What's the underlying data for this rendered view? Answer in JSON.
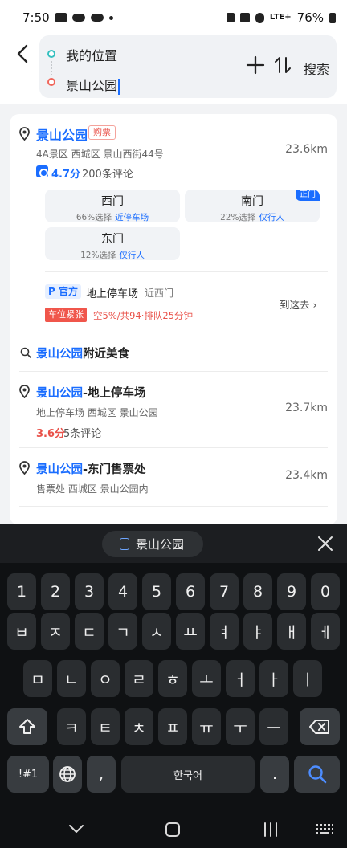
{
  "status": {
    "time": "7:50",
    "network": "LTE+",
    "battery": "76%"
  },
  "route": {
    "origin": "我的位置",
    "destination": "景山公园",
    "search_label": "搜索"
  },
  "results": {
    "primary": {
      "name": "景山公园",
      "badge": "购票",
      "meta": "4A景区  西城区 景山西街44号",
      "distance": "23.6km",
      "rating": "4.7分",
      "reviews": "200条评论",
      "gates": [
        {
          "name": "西门",
          "percent": "66%选择",
          "tip": "近停车场",
          "main": ""
        },
        {
          "name": "南门",
          "percent": "22%选择",
          "tip": "仅行人",
          "main": "正门"
        },
        {
          "name": "东门",
          "percent": "12%选择",
          "tip": "仅行人",
          "main": ""
        }
      ],
      "parking": {
        "badge": "P 官方",
        "name": "地上停车场",
        "near": "近西门",
        "status_badge": "车位紧张",
        "status_text": "空5%/共94·排队25分钟",
        "go_label": "到这去"
      }
    },
    "suggest": {
      "keyword": "景山公园",
      "suffix": "附近美食"
    },
    "items": [
      {
        "keyword": "景山公园",
        "suffix": "-地上停车场",
        "meta": "地上停车场  西城区 景山公园",
        "distance": "23.7km",
        "rating": "3.6分",
        "reviews": "5条评论"
      },
      {
        "keyword": "景山公园",
        "suffix": "-东门售票处",
        "meta": "售票处  西城区 景山公园内",
        "distance": "23.4km"
      }
    ]
  },
  "keyboard": {
    "suggestion": "景山公园",
    "row_numbers": [
      "1",
      "2",
      "3",
      "4",
      "5",
      "6",
      "7",
      "8",
      "9",
      "0"
    ],
    "row1": [
      "ㅂ",
      "ㅈ",
      "ㄷ",
      "ㄱ",
      "ㅅ",
      "ㅛ",
      "ㅕ",
      "ㅑ",
      "ㅐ",
      "ㅔ"
    ],
    "row2": [
      "ㅁ",
      "ㄴ",
      "ㅇ",
      "ㄹ",
      "ㅎ",
      "ㅗ",
      "ㅓ",
      "ㅏ",
      "ㅣ"
    ],
    "row3": [
      "ㅋ",
      "ㅌ",
      "ㅊ",
      "ㅍ",
      "ㅠ",
      "ㅜ",
      "ㅡ"
    ],
    "symbols_label": "!#1",
    "comma": ",",
    "space_label": "한국어",
    "period": "."
  }
}
